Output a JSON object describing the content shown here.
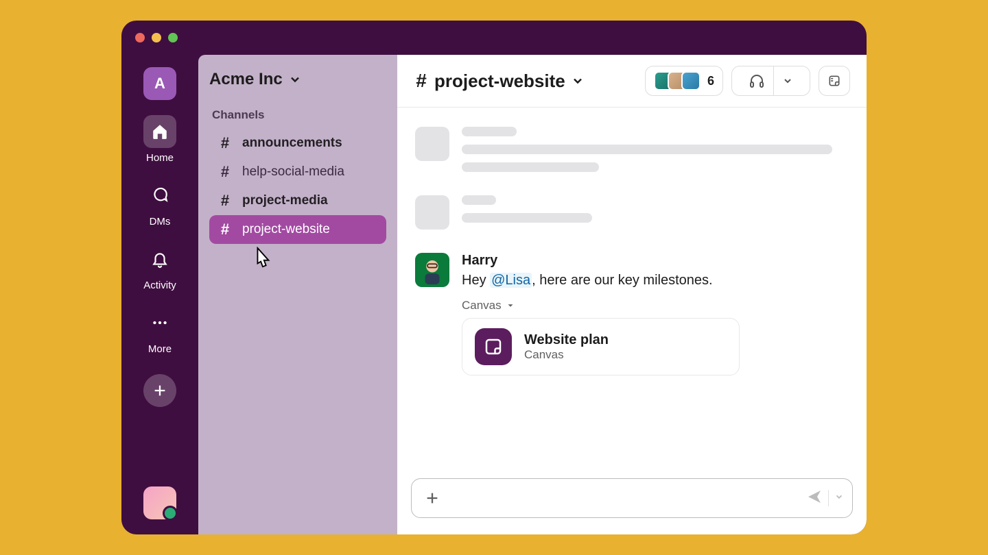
{
  "workspace": {
    "letter": "A",
    "name": "Acme Inc"
  },
  "rail": {
    "home": "Home",
    "dms": "DMs",
    "activity": "Activity",
    "more": "More"
  },
  "sidebar": {
    "section_label": "Channels",
    "channels": [
      {
        "name": "announcements",
        "bold": true,
        "selected": false
      },
      {
        "name": "help-social-media",
        "bold": false,
        "selected": false
      },
      {
        "name": "project-media",
        "bold": true,
        "selected": false
      },
      {
        "name": "project-website",
        "bold": false,
        "selected": true
      }
    ]
  },
  "channel_header": {
    "name": "project-website",
    "member_count": "6"
  },
  "message": {
    "author": "Harry",
    "text_prefix": "Hey ",
    "mention": "@Lisa",
    "text_suffix": ", here are our key milestones.",
    "attachment_label": "Canvas",
    "canvas_title": "Website plan",
    "canvas_sub": "Canvas"
  }
}
